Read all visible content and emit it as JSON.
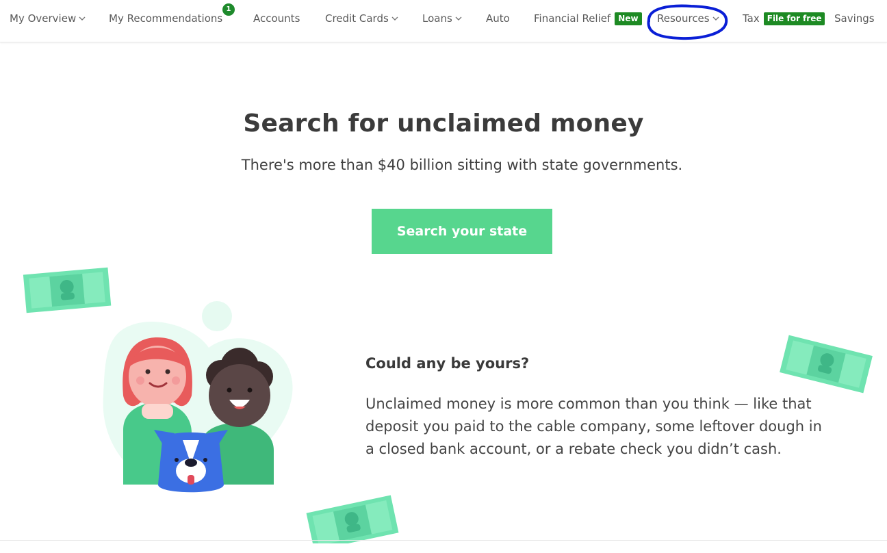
{
  "nav": {
    "my_overview": "My Overview",
    "my_recommendations": "My Recommendations",
    "recommendations_count": "1",
    "accounts": "Accounts",
    "credit_cards": "Credit Cards",
    "loans": "Loans",
    "auto": "Auto",
    "financial_relief": "Financial Relief",
    "financial_relief_tag": "New",
    "resources": "Resources",
    "tax": "Tax",
    "tax_tag": "File for free",
    "savings": "Savings"
  },
  "hero": {
    "title": "Search for unclaimed money",
    "subtitle": "There's more than $40 billion sitting with state governments.",
    "cta": "Search your state"
  },
  "info": {
    "heading": "Could any be yours?",
    "body": "Unclaimed money is more common than you think — like that deposit you paid to the cable company, some leftover dough in a closed bank account, or a rebate check you didn’t cash."
  },
  "colors": {
    "accent_green": "#57d68e",
    "tag_green": "#1d8a23",
    "annotation_blue": "#0a1fd6"
  },
  "icons": [
    "chevron-down-icon",
    "money-bill-icon",
    "people-dog-illustration"
  ]
}
